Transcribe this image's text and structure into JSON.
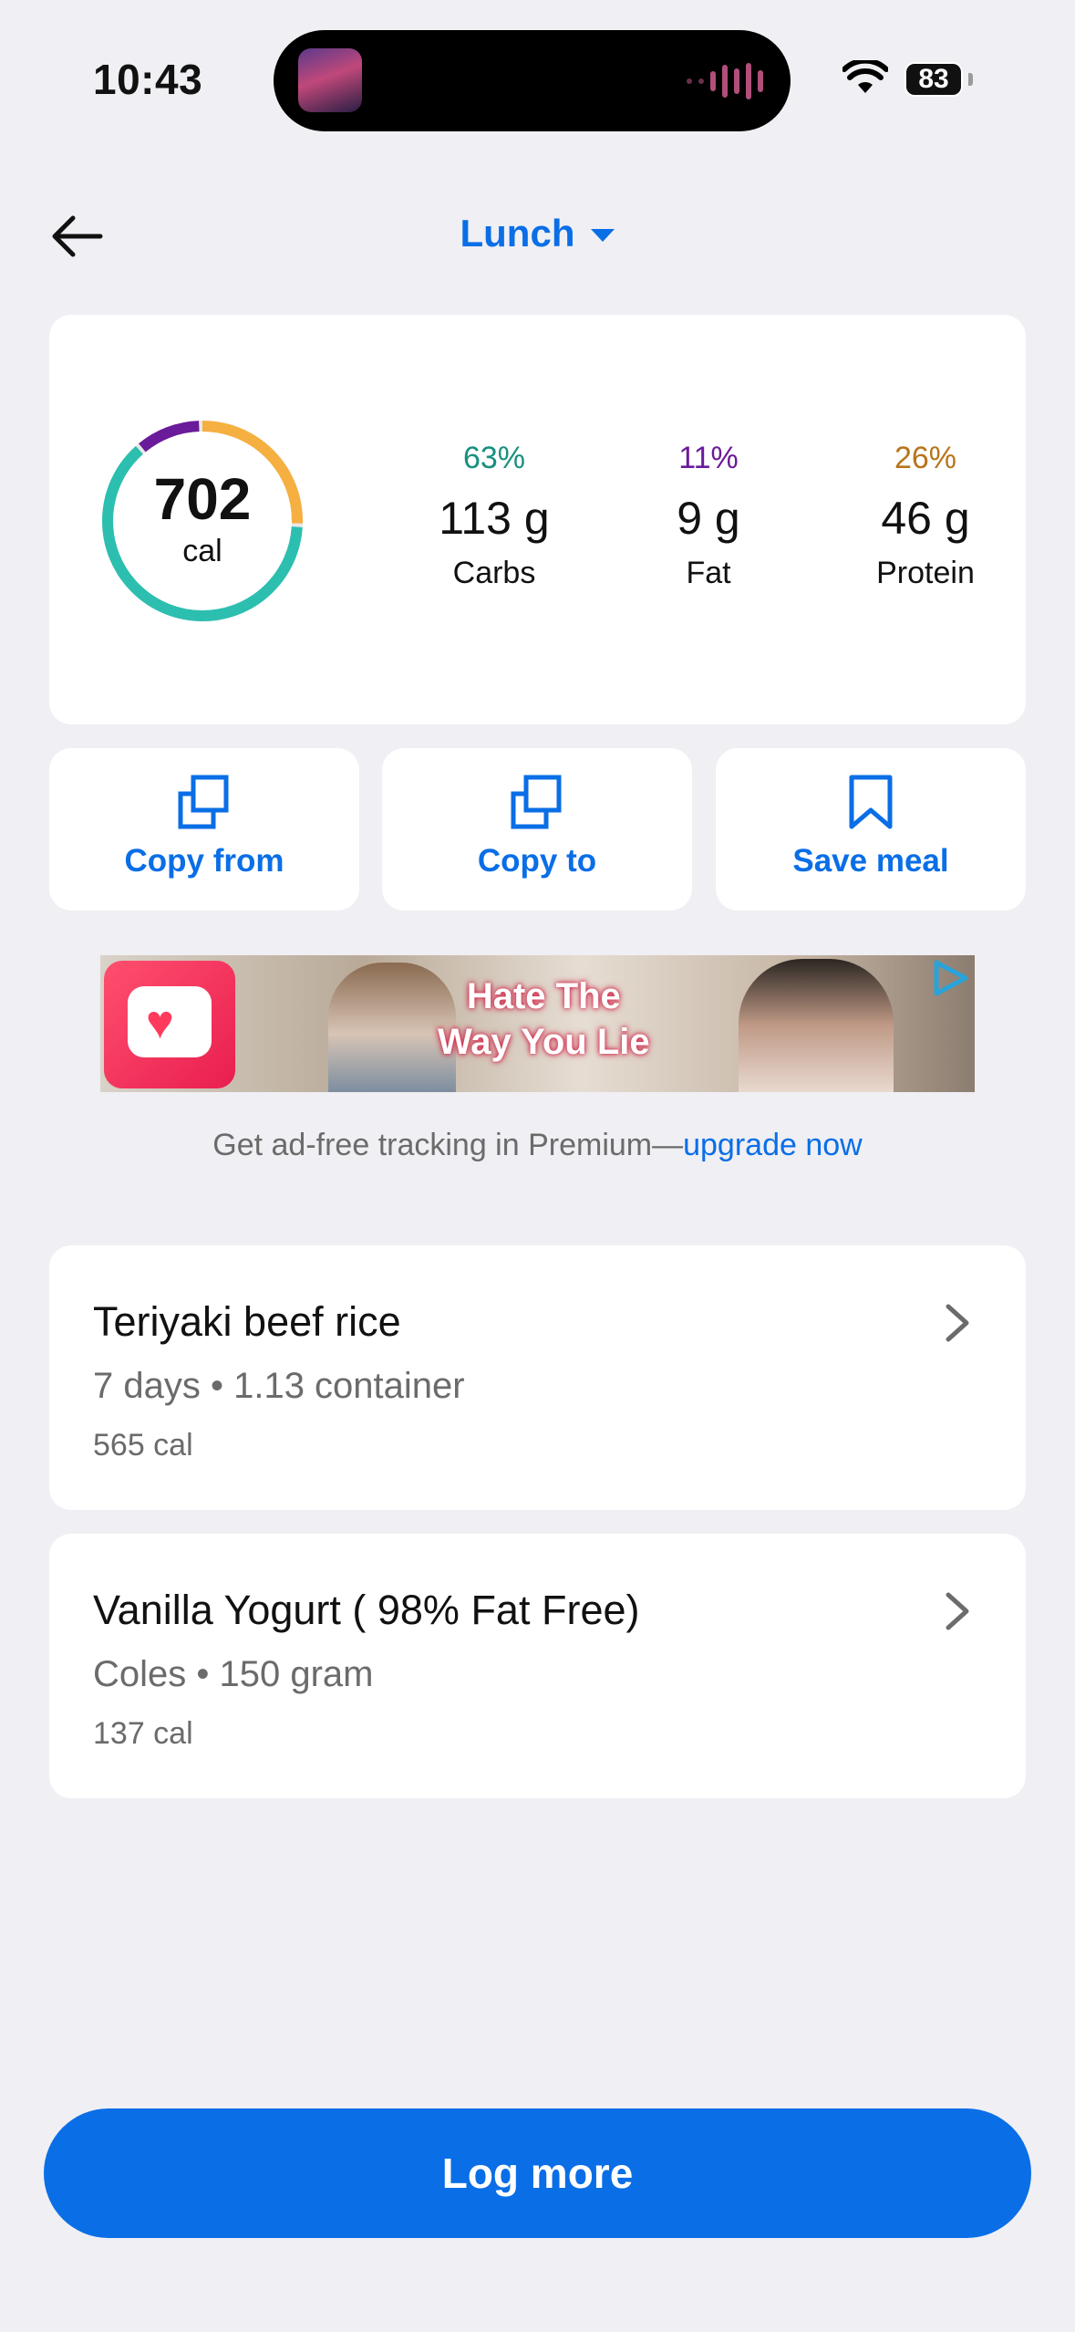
{
  "status_bar": {
    "time": "10:43",
    "battery": "83",
    "wifi_icon": "wifi-icon",
    "now_playing_icon": "album-art-icon"
  },
  "header": {
    "meal_name": "Lunch",
    "back_icon": "arrow-left-icon",
    "dropdown_icon": "caret-down-icon"
  },
  "summary": {
    "calories": "702",
    "calories_unit": "cal",
    "ring_colors": {
      "carbs": "#2cbfb0",
      "fat": "#6a1b9a",
      "protein": "#f5b041"
    },
    "macros": [
      {
        "pct": "63%",
        "amount": "113 g",
        "label": "Carbs",
        "color": "#18907f",
        "fraction": 0.63
      },
      {
        "pct": "11%",
        "amount": "9 g",
        "label": "Fat",
        "color": "#6a1b9a",
        "fraction": 0.11
      },
      {
        "pct": "26%",
        "amount": "46 g",
        "label": "Protein",
        "color": "#b8741a",
        "fraction": 0.26
      }
    ]
  },
  "actions": [
    {
      "label": "Copy from",
      "icon": "copy-icon"
    },
    {
      "label": "Copy to",
      "icon": "copy-icon"
    },
    {
      "label": "Save meal",
      "icon": "bookmark-icon"
    }
  ],
  "ad": {
    "headline_line1": "Hate The",
    "headline_line2": "Way You Lie",
    "choice_icon": "adchoices-icon"
  },
  "promo": {
    "text": "Get ad-free tracking in Premium—",
    "link": "upgrade now"
  },
  "foods": [
    {
      "name": "Teriyaki beef rice",
      "source": "7 days",
      "serving": "1.13 container",
      "calories": "565 cal"
    },
    {
      "name": "Vanilla Yogurt ( 98% Fat Free)",
      "source": "Coles",
      "serving": "150 gram",
      "calories": "137 cal"
    }
  ],
  "colors": {
    "accent": "#0a6ee6",
    "background": "#efeff4"
  },
  "log_more_label": "Log more"
}
